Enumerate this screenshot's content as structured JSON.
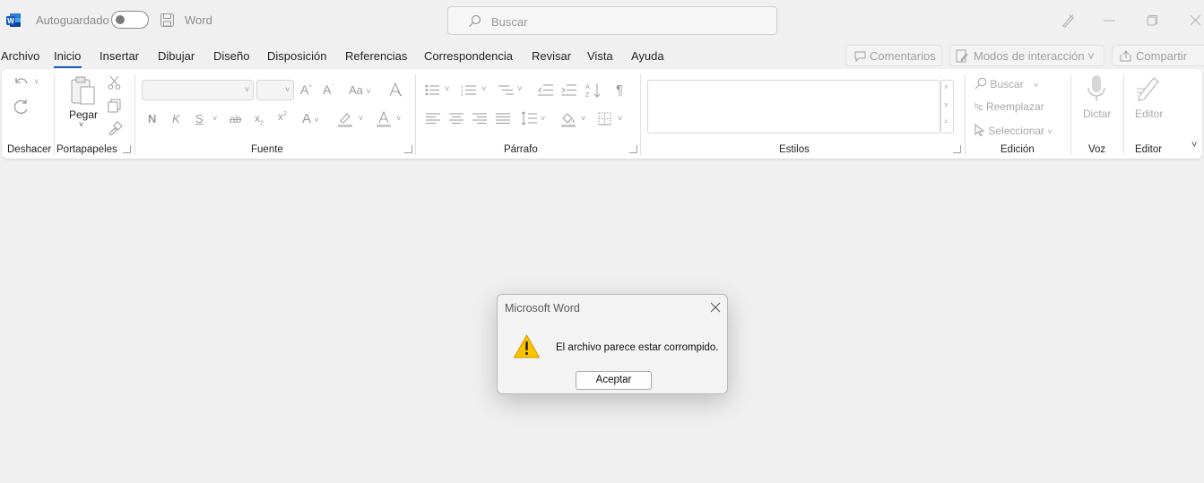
{
  "titlebar": {
    "autosave_label": "Autoguardado",
    "doc_title": "Word",
    "search_placeholder": "Buscar"
  },
  "menu": {
    "tabs": [
      {
        "label": "Archivo"
      },
      {
        "label": "Inicio"
      },
      {
        "label": "Insertar"
      },
      {
        "label": "Dibujar"
      },
      {
        "label": "Diseño"
      },
      {
        "label": "Disposición"
      },
      {
        "label": "Referencias"
      },
      {
        "label": "Correspondencia"
      },
      {
        "label": "Revisar"
      },
      {
        "label": "Vista"
      },
      {
        "label": "Ayuda"
      }
    ],
    "active_tab": "Inicio",
    "comments_label": "Comentarios",
    "modes_label": "Modos de interacción",
    "share_label": "Compartir"
  },
  "ribbon": {
    "groups": {
      "undo": "Deshacer",
      "clipboard": "Portapapeles",
      "font": "Fuente",
      "paragraph": "Párrafo",
      "styles": "Estilos",
      "editing": "Edición",
      "voice": "Voz",
      "editor": "Editor"
    },
    "paste_label": "Pegar",
    "find_label": "Buscar",
    "replace_label": "Reemplazar",
    "select_label": "Seleccionar",
    "dictate_label": "Dictar",
    "editor_label": "Editor",
    "bold_glyph": "N",
    "italic_glyph": "K",
    "underline_glyph": "S",
    "strike_glyph": "ab",
    "case_glyph": "Aa"
  },
  "dialog": {
    "title": "Microsoft Word",
    "message": "El archivo parece estar corrompido.",
    "ok_label": "Aceptar"
  },
  "colors": {
    "accent": "#185abd",
    "warning": "#f2b400",
    "word_brand": "#185abd"
  }
}
